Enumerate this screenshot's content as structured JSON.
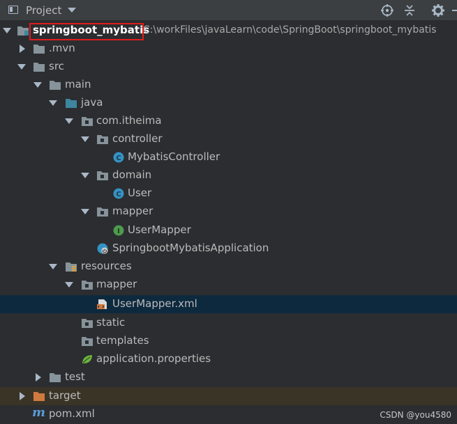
{
  "header": {
    "title": "Project"
  },
  "tree": {
    "root_label": "springboot_mybatis",
    "root_path": "C:\\workFiles\\javaLearn\\code\\SpringBoot\\springboot_mybatis",
    "items": [
      {
        "label": ".mvn"
      },
      {
        "label": "src"
      },
      {
        "label": "main"
      },
      {
        "label": "java"
      },
      {
        "label": "com.itheima"
      },
      {
        "label": "controller"
      },
      {
        "label": "MybatisController"
      },
      {
        "label": "domain"
      },
      {
        "label": "User"
      },
      {
        "label": "mapper"
      },
      {
        "label": "UserMapper"
      },
      {
        "label": "SpringbootMybatisApplication"
      },
      {
        "label": "resources"
      },
      {
        "label": "mapper"
      },
      {
        "label": "UserMapper.xml"
      },
      {
        "label": "static"
      },
      {
        "label": "templates"
      },
      {
        "label": "application.properties"
      },
      {
        "label": "test"
      },
      {
        "label": "target"
      },
      {
        "label": "pom.xml"
      }
    ]
  },
  "icons": {
    "class_letter": "C",
    "interface_letter": "I",
    "maven_letter": "m"
  },
  "colors": {
    "selected_row": "#0d293e",
    "highlight_box": "#e01c1c",
    "class_icon": "#3592c4",
    "interface_icon": "#4e9a4e",
    "folder_icon": "#87939a",
    "source_folder_icon": "#3e86a0",
    "excluded_folder_icon": "#d07a3e"
  },
  "watermark": "CSDN @you4580"
}
